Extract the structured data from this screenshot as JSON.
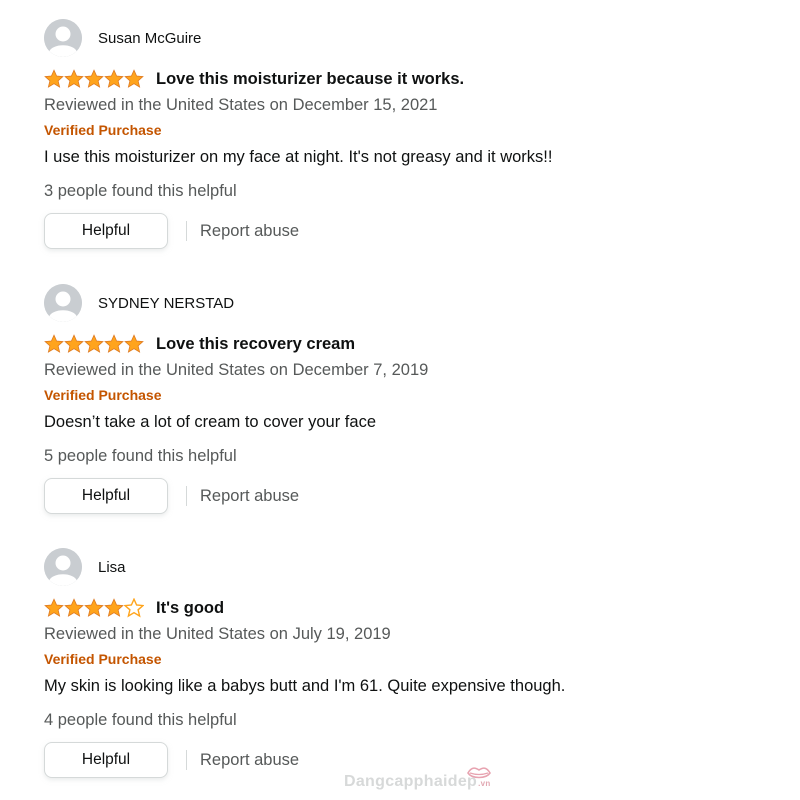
{
  "colors": {
    "star": "#ffa41c",
    "verified": "#c45500",
    "muted": "#565959",
    "text": "#0f1111",
    "button_border": "#d5d9d9"
  },
  "reviews": [
    {
      "author": "Susan McGuire",
      "rating": 5,
      "rating_max": 5,
      "title": "Love this moisturizer because it works.",
      "date": "Reviewed in the United States on December 15, 2021",
      "verified": "Verified Purchase",
      "body": "I use this moisturizer on my face at night. It's not greasy and it works!!",
      "helpful_count": "3 people found this helpful",
      "helpful_label": "Helpful",
      "report_label": "Report abuse",
      "avatar_icon": "user-avatar-icon"
    },
    {
      "author": "SYDNEY NERSTAD",
      "rating": 5,
      "rating_max": 5,
      "title": "Love this recovery cream",
      "date": "Reviewed in the United States on December 7, 2019",
      "verified": "Verified Purchase",
      "body": "Doesn’t take a lot of cream to cover your face",
      "helpful_count": "5 people found this helpful",
      "helpful_label": "Helpful",
      "report_label": "Report abuse",
      "avatar_icon": "user-avatar-icon"
    },
    {
      "author": "Lisa",
      "rating": 4,
      "rating_max": 5,
      "title": "It's good",
      "date": "Reviewed in the United States on July 19, 2019",
      "verified": "Verified Purchase",
      "body": "My skin is looking like a babys butt and I'm 61. Quite expensive though.",
      "helpful_count": "4 people found this helpful",
      "helpful_label": "Helpful",
      "report_label": "Report abuse",
      "avatar_icon": "user-avatar-icon"
    }
  ],
  "watermark": {
    "text": "Dangcapphaidep",
    "suffix": ".vn"
  }
}
